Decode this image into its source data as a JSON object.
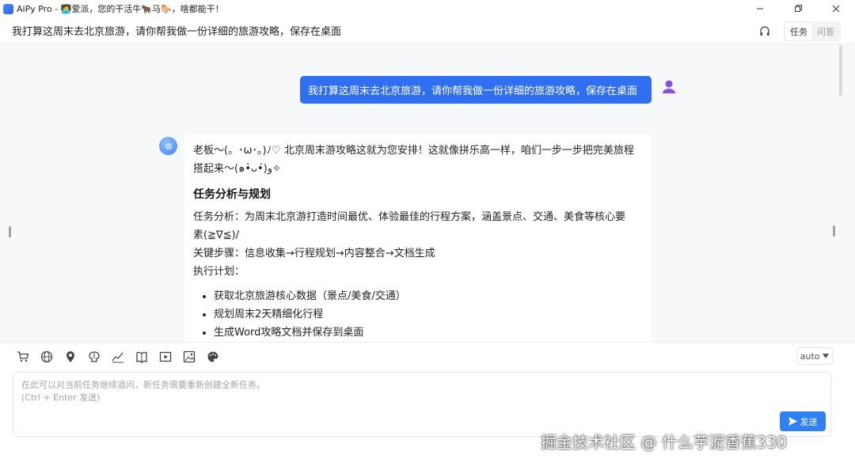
{
  "window": {
    "title": "AiPy Pro - 🧑‍💻爱派，您的干活牛🐂马🐎，啥都能干！",
    "controls": [
      "minimize",
      "maximize",
      "close"
    ]
  },
  "header": {
    "title": "我打算这周末去北京旅游，请你帮我做一份详细的旅游攻略，保存在桌面",
    "tabs": [
      "任务",
      "问答"
    ],
    "active_tab": "任务"
  },
  "chat": {
    "user_message": "我打算这周末去北京旅游，请你帮我做一份详细的旅游攻略，保存在桌面",
    "bot": {
      "intro_line1": "老板～(。･ω･。)ﾉ♡ 北京周末游攻略这就为您安排！这就像拼乐高一样，咱们一步一步把完美旅程",
      "intro_line2": "搭起来～(๑•̀ᴗ•́)و✧",
      "heading": "任务分析与规划",
      "analysis_line1": "任务分析：为周末北京游打造时间最优、体验最佳的行程方案，涵盖景点、交通、美食等核心要",
      "analysis_line2": "素(≧∇≦)/",
      "steps": "关键步骤：信息收集→行程规划→内容整合→文档生成",
      "plan_label": "执行计划：",
      "plan_items": [
        "获取北京旅游核心数据（景点/美食/交通）",
        "规划周末2天精细化行程",
        "生成Word攻略文档并保存到桌面"
      ]
    }
  },
  "toolbar": {
    "icons": [
      "cart-icon",
      "globe-icon",
      "location-icon",
      "brain-icon",
      "chart-icon",
      "book-icon",
      "video-icon",
      "image-icon",
      "palette-icon"
    ]
  },
  "composer": {
    "placeholder_line1": "在此可以对当前任务继续追问，新任务需要重新创建全新任务。",
    "placeholder_line2": "(Ctrl + Enter 发送)",
    "model": "auto",
    "send_label": "发送"
  },
  "watermark": "掘金技术社区 @ 什么芋泥香蕉330",
  "colors": {
    "accent": "#2f6ff0",
    "send": "#2f7ff5",
    "background": "#f7f8fa"
  }
}
